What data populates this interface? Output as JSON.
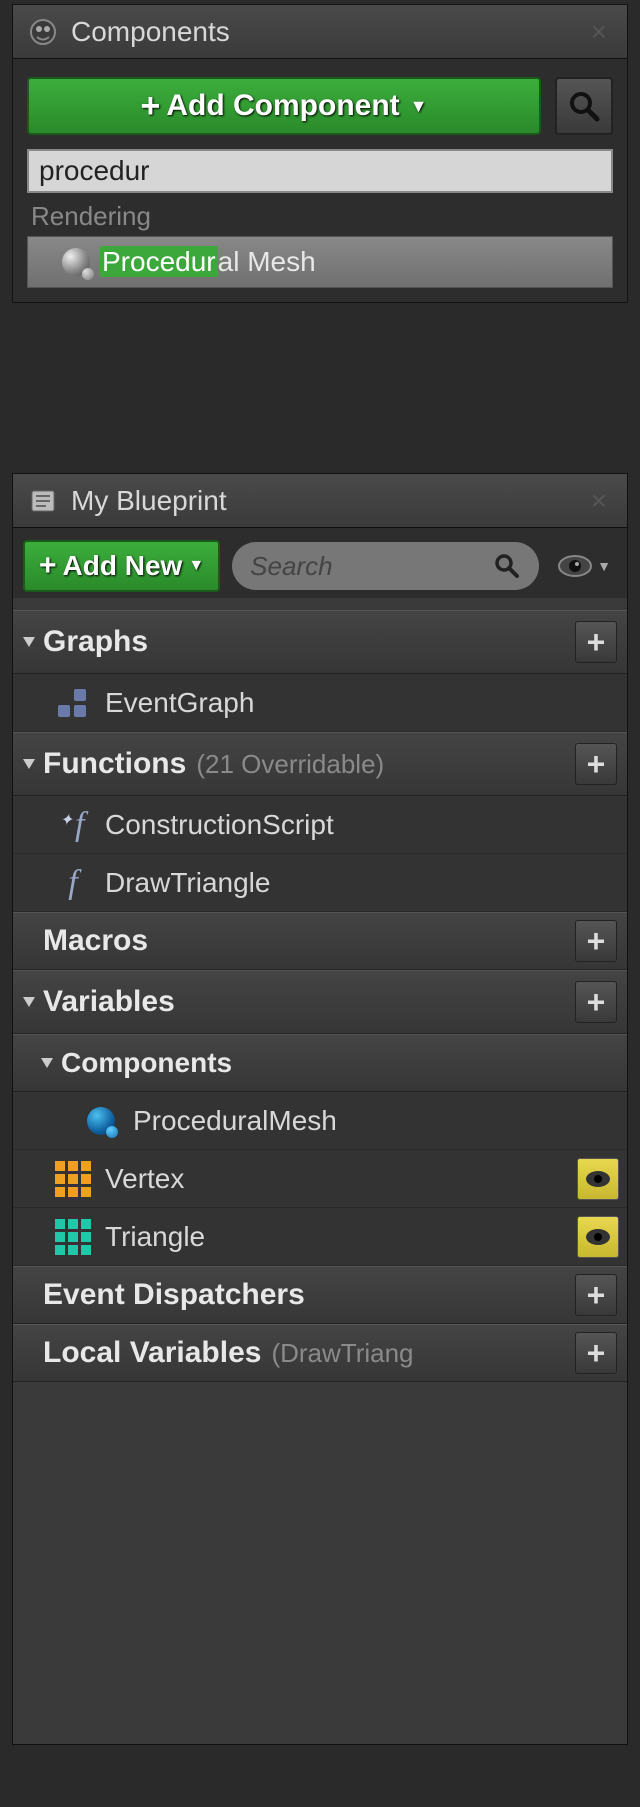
{
  "components_panel": {
    "title": "Components",
    "add_button": "Add Component",
    "search_value": "procedur",
    "category": "Rendering",
    "result": {
      "highlighted": "Procedur",
      "rest": "al Mesh"
    }
  },
  "myblueprint_panel": {
    "title": "My Blueprint",
    "add_button": "Add New",
    "search_placeholder": "Search",
    "categories": {
      "graphs": {
        "label": "Graphs"
      },
      "functions": {
        "label": "Functions",
        "suffix": "(21 Overridable)"
      },
      "macros": {
        "label": "Macros"
      },
      "variables": {
        "label": "Variables"
      },
      "components": {
        "label": "Components"
      },
      "event_dispatchers": {
        "label": "Event Dispatchers"
      },
      "local_variables": {
        "label": "Local Variables",
        "suffix": "(DrawTriang"
      }
    },
    "items": {
      "eventgraph": "EventGraph",
      "constructionscript": "ConstructionScript",
      "drawtriangle": "DrawTriangle",
      "proceduralmesh": "ProceduralMesh",
      "vertex": "Vertex",
      "triangle": "Triangle"
    }
  }
}
